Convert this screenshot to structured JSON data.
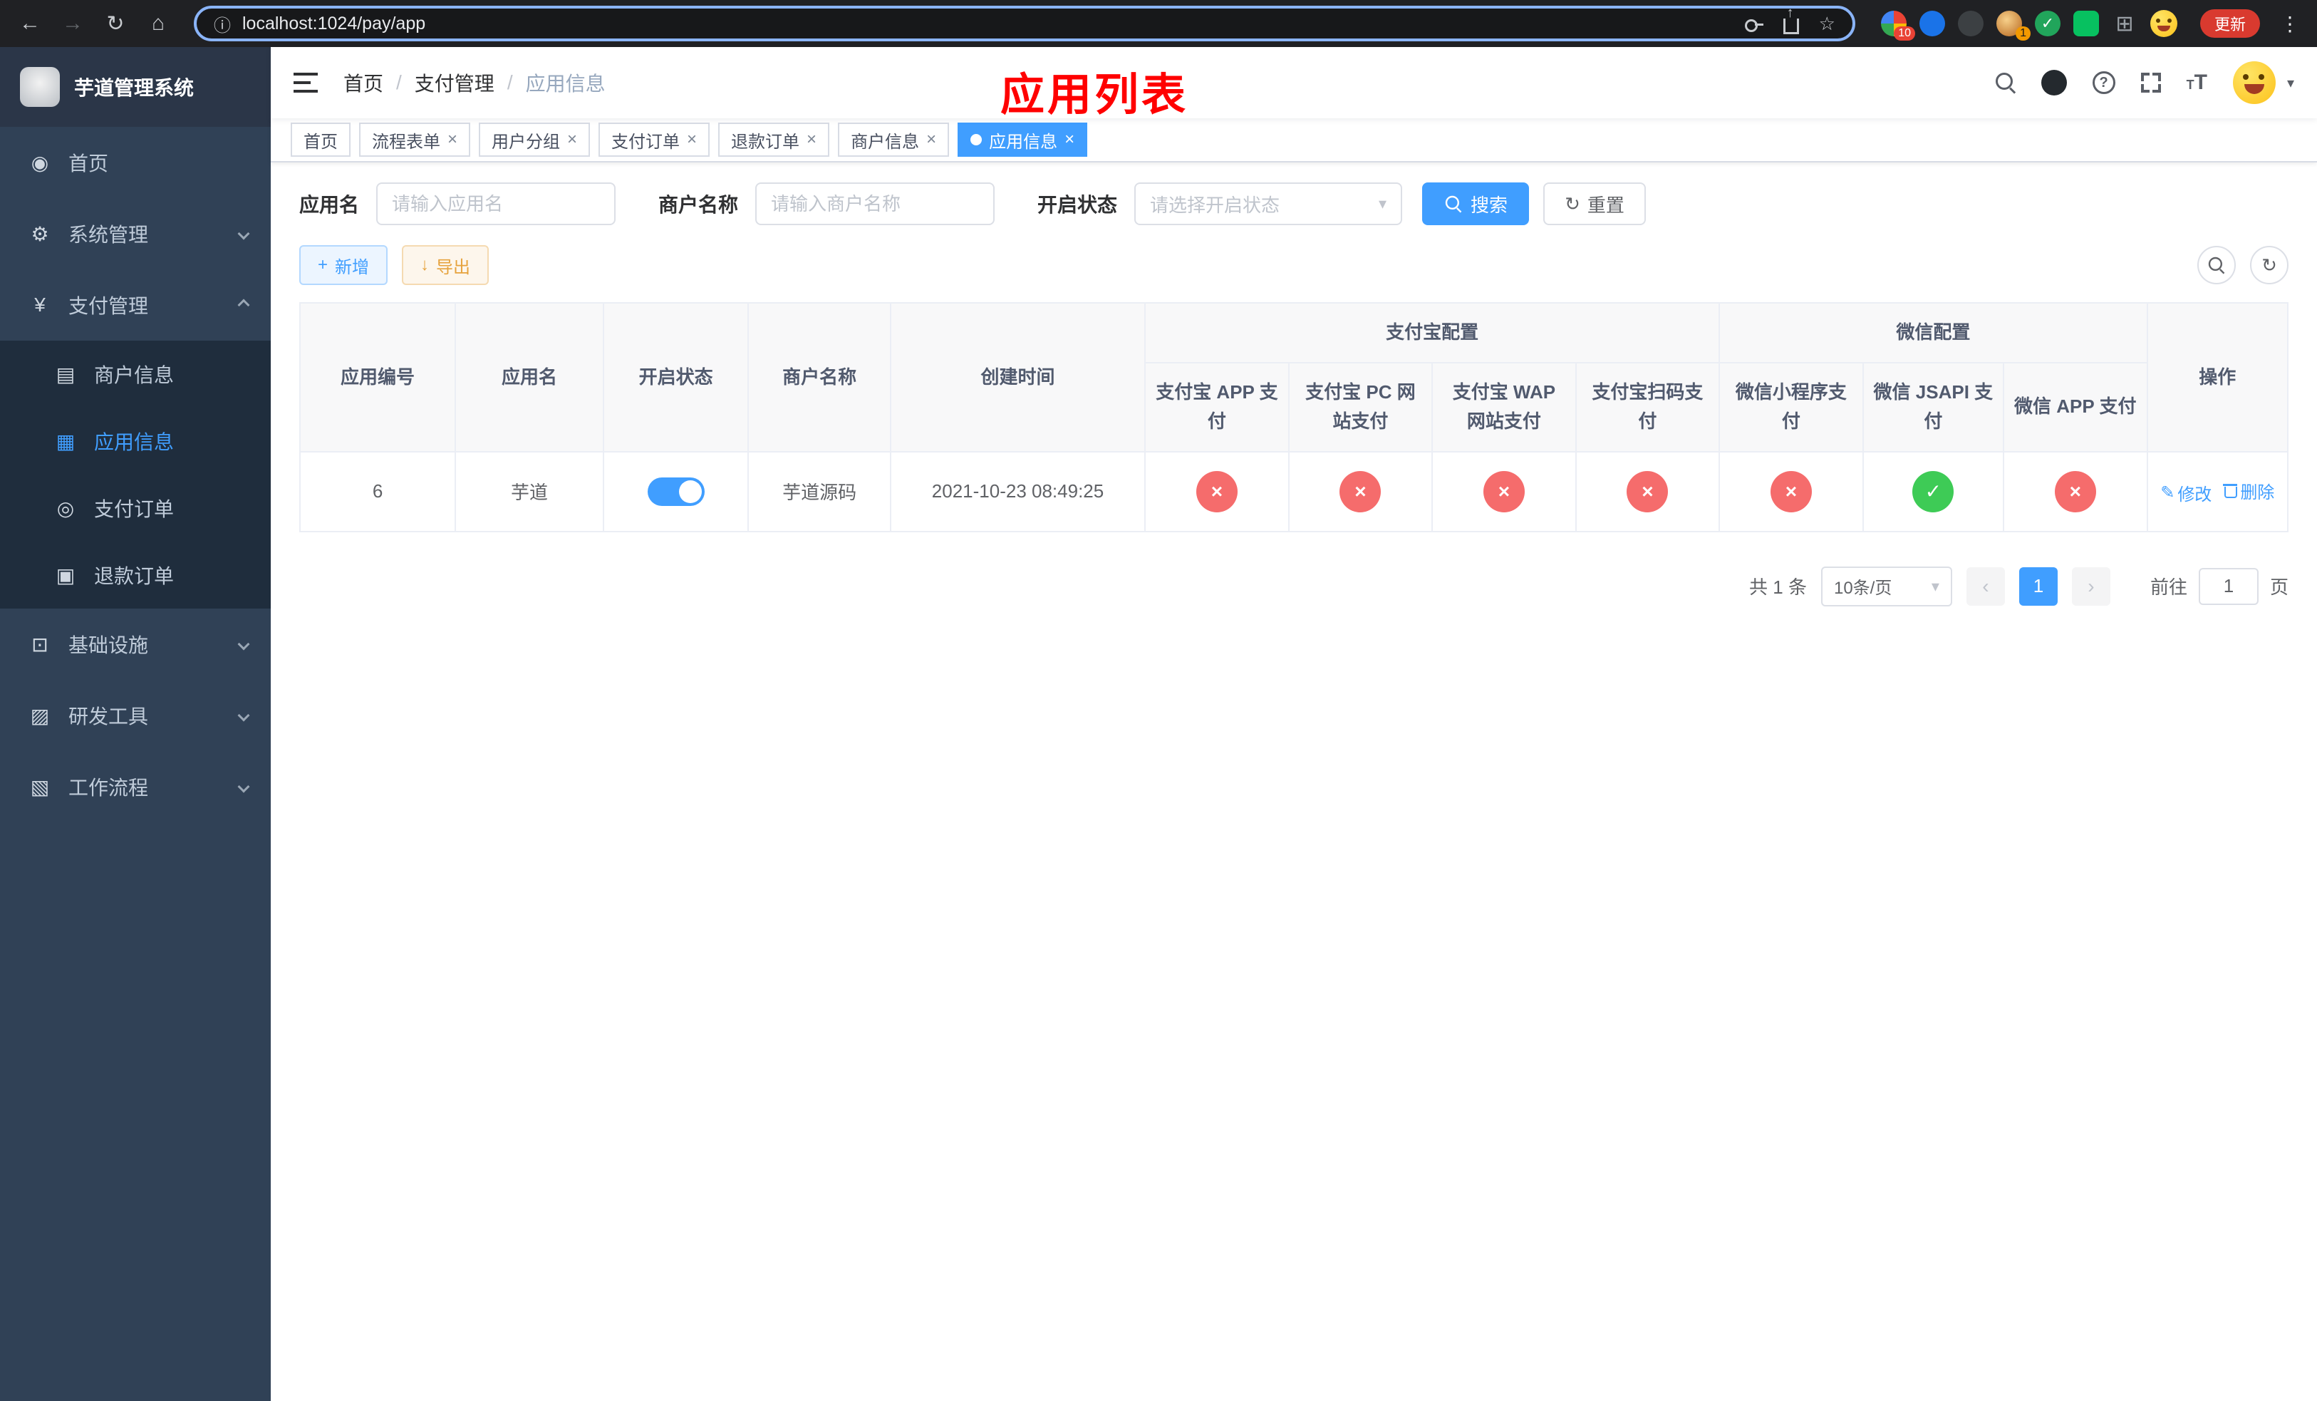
{
  "icons": {
    "back": "←",
    "forward": "→",
    "refresh": "↻",
    "home": "⌂",
    "info": "ⓘ",
    "star": "☆",
    "extensions": "⊞",
    "menu_dots": "⋮",
    "close": "×",
    "caret_down": "▾",
    "plus": "+",
    "download": "↓",
    "check": "✓",
    "cross": "×",
    "edit": "✎",
    "prev": "‹",
    "next": "›",
    "check_small": "✓",
    "font_big": "T",
    "font_small": "T",
    "help": "?",
    "dashboard": "◉",
    "gear": "⚙",
    "yen": "¥",
    "merchant": "▤",
    "app": "▦",
    "order": "◎",
    "refund": "▣",
    "infra": "⊡",
    "devtool": "▨",
    "workflow": "▧"
  },
  "browser": {
    "url": "localhost:1024/pay/app",
    "update_label": "更新",
    "ext_badge_1": "10",
    "ext_badge_2": "1"
  },
  "sidebar": {
    "title": "芋道管理系统",
    "menu": [
      {
        "label": "首页"
      },
      {
        "label": "系统管理"
      },
      {
        "label": "支付管理"
      },
      {
        "label": "基础设施"
      },
      {
        "label": "研发工具"
      },
      {
        "label": "工作流程"
      }
    ],
    "submenu": [
      {
        "label": "商户信息"
      },
      {
        "label": "应用信息"
      },
      {
        "label": "支付订单"
      },
      {
        "label": "退款订单"
      }
    ]
  },
  "header": {
    "breadcrumb": [
      "首页",
      "支付管理",
      "应用信息"
    ],
    "annotation": "应用列表"
  },
  "tabs": [
    {
      "label": "首页"
    },
    {
      "label": "流程表单"
    },
    {
      "label": "用户分组"
    },
    {
      "label": "支付订单"
    },
    {
      "label": "退款订单"
    },
    {
      "label": "商户信息"
    },
    {
      "label": "应用信息"
    }
  ],
  "filters": {
    "app_name_label": "应用名",
    "app_name_placeholder": "请输入应用名",
    "merchant_label": "商户名称",
    "merchant_placeholder": "请输入商户名称",
    "status_label": "开启状态",
    "status_placeholder": "请选择开启状态",
    "search_button": "搜索",
    "reset_button": "重置"
  },
  "toolbar": {
    "add_button": "新增",
    "export_button": "导出"
  },
  "table": {
    "simple_columns": [
      "应用编号",
      "应用名",
      "开启状态",
      "商户名称",
      "创建时间"
    ],
    "groups": [
      {
        "label": "支付宝配置",
        "children": [
          "支付宝 APP 支付",
          "支付宝 PC 网站支付",
          "支付宝 WAP 网站支付",
          "支付宝扫码支付"
        ]
      },
      {
        "label": "微信配置",
        "children": [
          "微信小程序支付",
          "微信 JSAPI 支付",
          "微信 APP 支付"
        ]
      }
    ],
    "ops_column": "操作",
    "rows": [
      {
        "id": "6",
        "name": "芋道",
        "enabled": true,
        "merchant": "芋道源码",
        "created_at": "2021-10-23 08:49:25",
        "channels": [
          "no",
          "no",
          "no",
          "no",
          "no",
          "yes",
          "no"
        ],
        "edit_label": "修改",
        "delete_label": "删除"
      }
    ]
  },
  "pagination": {
    "total": "共 1 条",
    "page_size": "10条/页",
    "page": "1",
    "goto_label": "前往",
    "goto_value": "1",
    "unit_label": "页"
  }
}
